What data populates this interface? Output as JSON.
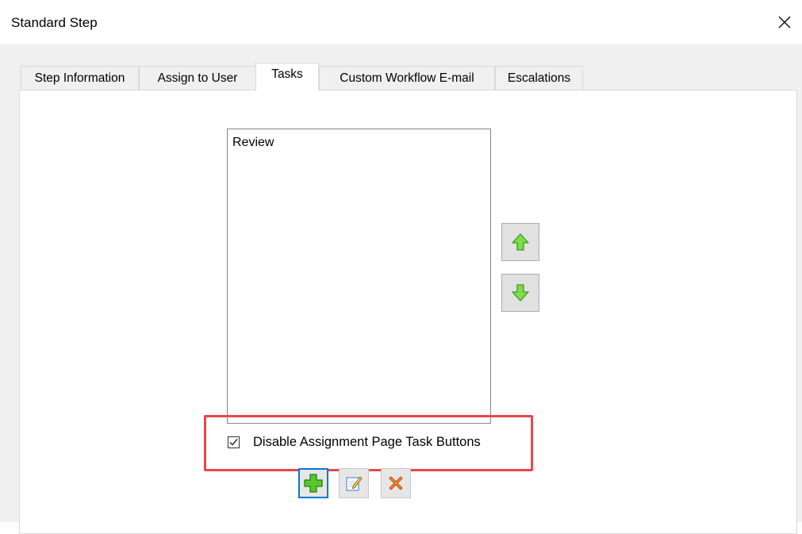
{
  "window": {
    "title": "Standard Step"
  },
  "tabs": [
    {
      "label": "Step Information",
      "active": false
    },
    {
      "label": "Assign to User",
      "active": false
    },
    {
      "label": "Tasks",
      "active": true
    },
    {
      "label": "Custom Workflow E-mail",
      "active": false
    },
    {
      "label": "Escalations",
      "active": false
    }
  ],
  "task_list": {
    "items": [
      "Review"
    ]
  },
  "move_buttons": {
    "up_icon": "green-up-arrow-icon",
    "down_icon": "green-down-arrow-icon"
  },
  "option": {
    "label": "Disable Assignment Page Task Buttons",
    "checked": true
  },
  "task_buttons": {
    "add_icon": "green-plus-icon",
    "edit_icon": "edit-pencil-icon",
    "delete_icon": "orange-x-icon"
  },
  "colors": {
    "highlight": "#e8464b",
    "arrow_green": "#6fcf3a",
    "focus_blue": "#0078d7",
    "delete_orange": "#f07a2a"
  }
}
